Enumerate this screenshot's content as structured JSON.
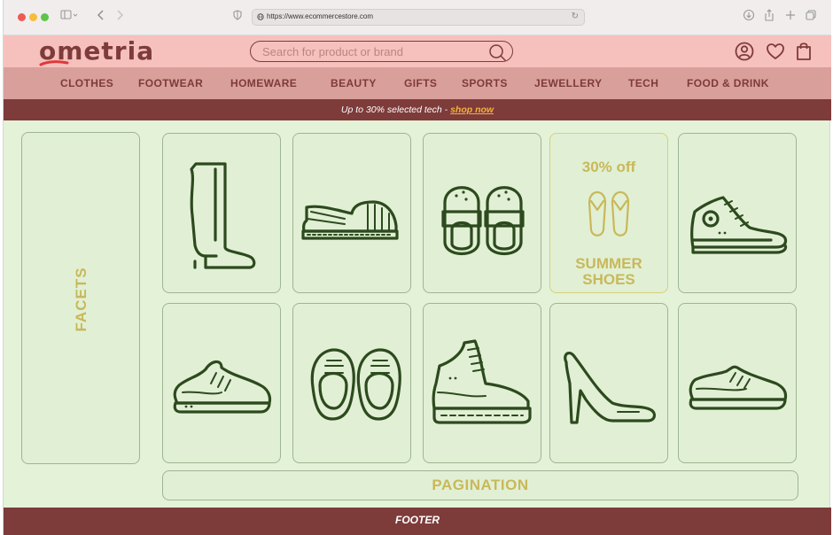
{
  "browser": {
    "url": "https://www.ecommercestore.com"
  },
  "header": {
    "logo": "ometria",
    "search_placeholder": "Search for product or brand"
  },
  "nav": {
    "items": [
      {
        "label": "CLOTHES"
      },
      {
        "label": "FOOTWEAR"
      },
      {
        "label": "HOMEWARE"
      },
      {
        "label": "BEAUTY"
      },
      {
        "label": "GIFTS"
      },
      {
        "label": "SPORTS"
      },
      {
        "label": "JEWELLERY"
      },
      {
        "label": "TECH"
      },
      {
        "label": "FOOD & DRINK"
      }
    ]
  },
  "banner": {
    "text": "Up to 30% selected tech - ",
    "link": "shop now"
  },
  "facets": {
    "label": "FACETS"
  },
  "products": [
    {
      "icon": "boot-icon"
    },
    {
      "icon": "espadrille-icon"
    },
    {
      "icon": "slippers-icon"
    },
    {
      "icon": "hightop-sneaker-icon"
    },
    {
      "icon": "running-shoe-icon"
    },
    {
      "icon": "shoes-pair-icon"
    },
    {
      "icon": "hiking-boot-icon"
    },
    {
      "icon": "high-heel-icon"
    },
    {
      "icon": "sneaker-icon"
    }
  ],
  "promo": {
    "discount": "30% off",
    "title_line1": "SUMMER",
    "title_line2": "SHOES",
    "icon": "flip-flops-icon"
  },
  "pagination": {
    "label": "PAGINATION"
  },
  "footer": {
    "label": "FOOTER"
  },
  "colors": {
    "brand": "#7d3b3a",
    "header_bg": "#f6c0bd",
    "nav_bg": "#d99f9b",
    "content_bg": "#e4f2d8",
    "accent_gold": "#c9b85a",
    "link": "#f1b23e"
  }
}
